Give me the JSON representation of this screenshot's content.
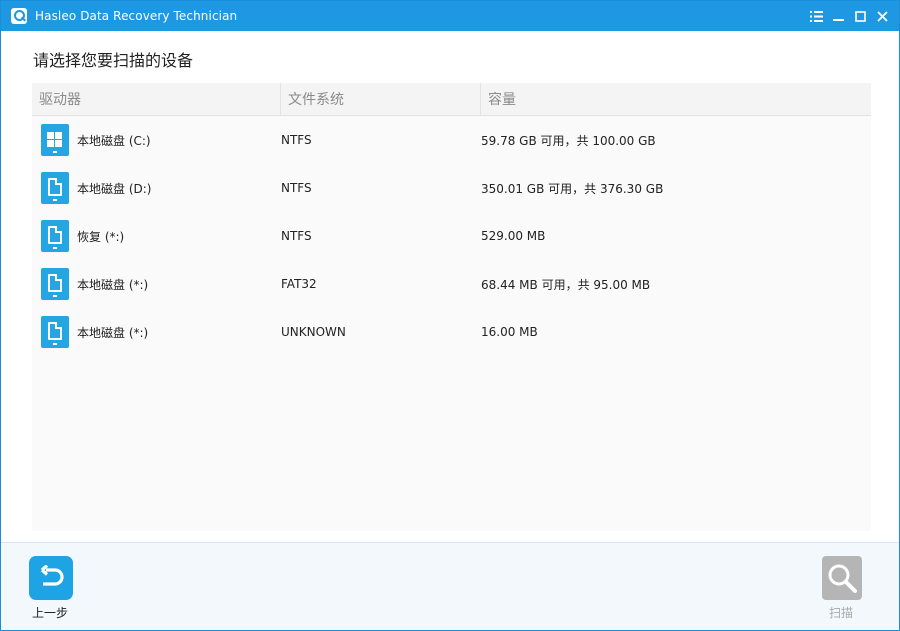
{
  "window": {
    "title": "Hasleo Data Recovery Technician"
  },
  "heading": "请选择您要扫描的设备",
  "table": {
    "columns": [
      "驱动器",
      "文件系统",
      "容量"
    ],
    "rows": [
      {
        "icon": "windows-drive-icon",
        "name": "本地磁盘 (C:)",
        "fs": "NTFS",
        "capacity": "59.78 GB 可用，共 100.00 GB"
      },
      {
        "icon": "document-drive-icon",
        "name": "本地磁盘 (D:)",
        "fs": "NTFS",
        "capacity": "350.01 GB 可用，共 376.30 GB"
      },
      {
        "icon": "document-drive-icon",
        "name": "恢复 (*:)",
        "fs": "NTFS",
        "capacity": "529.00 MB"
      },
      {
        "icon": "document-drive-icon",
        "name": "本地磁盘 (*:)",
        "fs": "FAT32",
        "capacity": "68.44 MB 可用，共 95.00 MB"
      },
      {
        "icon": "document-drive-icon",
        "name": "本地磁盘 (*:)",
        "fs": "UNKNOWN",
        "capacity": "16.00 MB"
      }
    ]
  },
  "footer": {
    "back_label": "上一步",
    "scan_label": "扫描"
  },
  "colors": {
    "accent": "#1e98e2",
    "icon_blue": "#23a6e2",
    "disabled": "#b5b5b5"
  }
}
